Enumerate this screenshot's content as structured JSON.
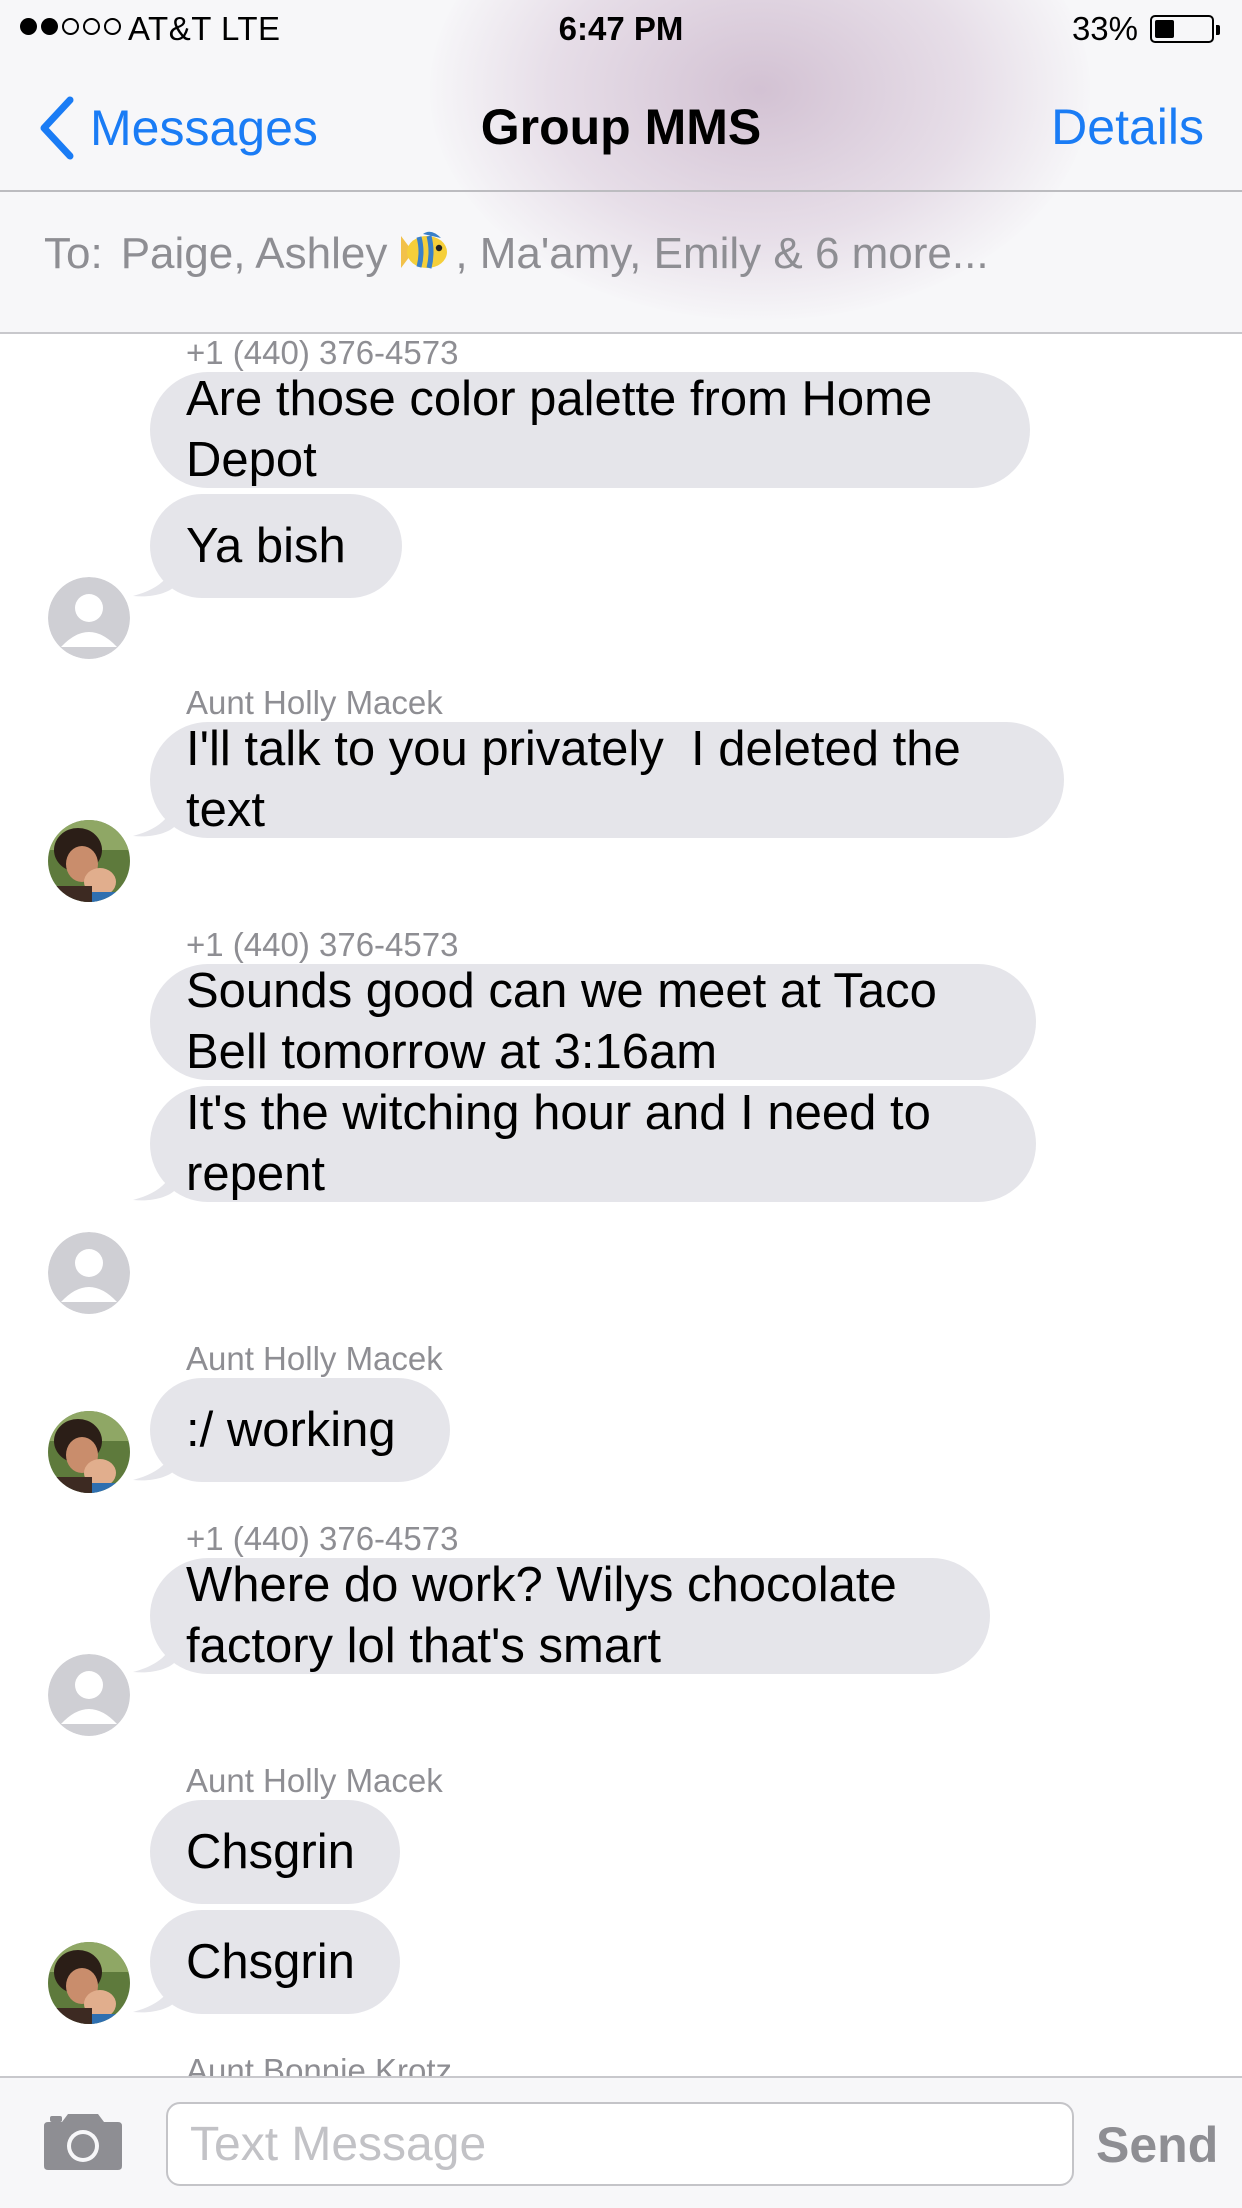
{
  "status_bar": {
    "carrier": "AT&T  LTE",
    "time": "6:47 PM",
    "battery_percent": "33%",
    "battery_level": 0.33,
    "signal_bars_filled": 2,
    "signal_bars_total": 5
  },
  "nav": {
    "back_label": "Messages",
    "title": "Group MMS",
    "details_label": "Details"
  },
  "recipients": {
    "prefix": "To:",
    "before_emoji": "Paige, Ashley",
    "emoji": "tropical-fish-icon",
    "after_emoji": ", Ma'amy, Emily & 6 more..."
  },
  "conversation": {
    "groups": [
      {
        "sender": "+1 (440) 376-4573",
        "avatar": "default-contact-icon",
        "messages": [
          "Are those color palette from Home Depot",
          "Ya bish"
        ]
      },
      {
        "sender": "Aunt Holly Macek",
        "avatar": "contact-photo",
        "messages": [
          "I'll talk to you privately  I deleted the text"
        ]
      },
      {
        "sender": "+1 (440) 376-4573",
        "avatar": "default-contact-icon",
        "messages": [
          "Sounds good can we meet at Taco Bell tomorrow at 3:16am",
          "It's the witching hour and I need to repent"
        ]
      },
      {
        "sender": "Aunt Holly Macek",
        "avatar": "contact-photo",
        "messages": [
          ":/ working"
        ]
      },
      {
        "sender": "+1 (440) 376-4573",
        "avatar": "default-contact-icon",
        "messages": [
          "Where do work? Wilys chocolate factory lol that's smart"
        ]
      },
      {
        "sender": "Aunt Holly Macek",
        "avatar": "contact-photo",
        "messages": [
          "Chsgrin",
          "Chsgrin"
        ]
      },
      {
        "sender": "Aunt Bonnie Krotz",
        "avatar": null,
        "messages": []
      }
    ]
  },
  "composer": {
    "camera_icon": "camera-icon",
    "placeholder": "Text Message",
    "value": "",
    "send_label": "Send"
  },
  "colors": {
    "accent": "#1a7cf5",
    "bubble": "#e5e5ea",
    "secondary_text": "#8e8e93"
  }
}
